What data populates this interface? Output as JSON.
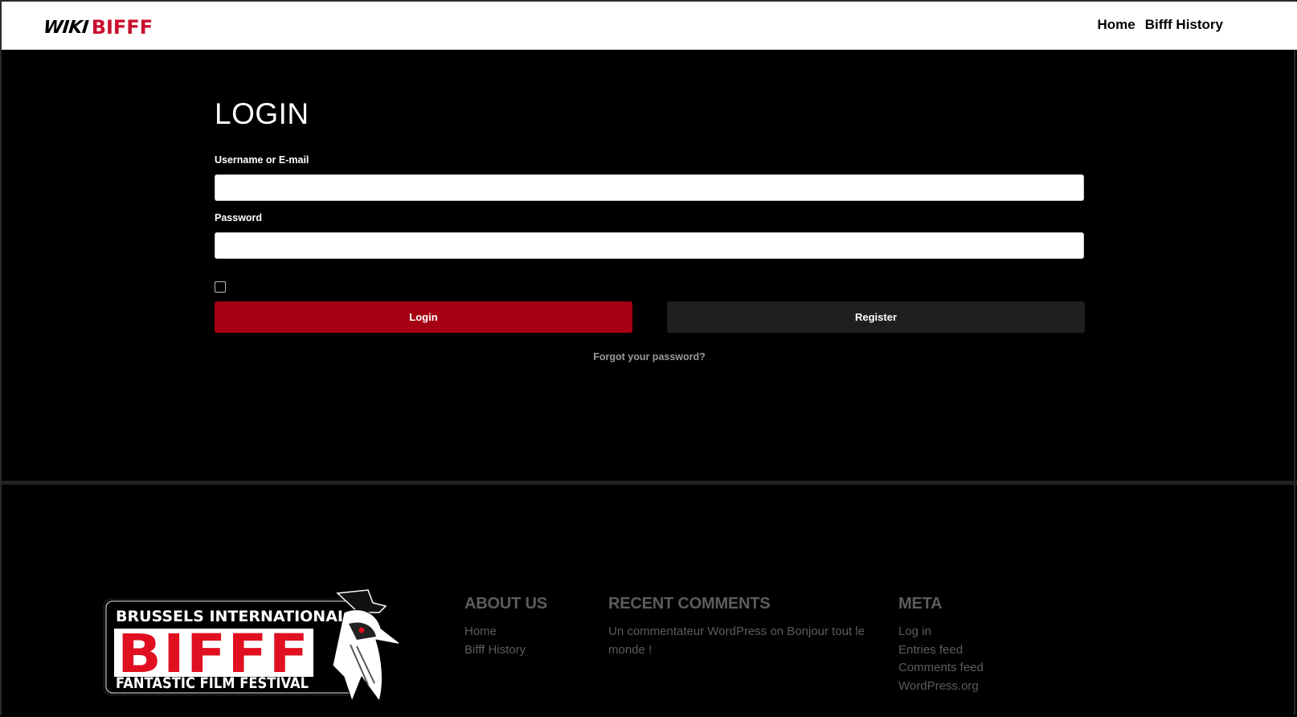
{
  "header": {
    "logo": {
      "wiki": "WIKI",
      "brand": "BIFFF"
    },
    "nav": [
      {
        "label": "Home"
      },
      {
        "label": "Bifff History"
      }
    ]
  },
  "login": {
    "title": "LOGIN",
    "username_label": "Username or E-mail",
    "username_value": "",
    "password_label": "Password",
    "password_value": "",
    "remember_checked": false,
    "login_button": "Login",
    "register_button": "Register",
    "forgot_link": "Forgot your password?"
  },
  "footer": {
    "logo": {
      "top_text": "BRUSSELS INTERNATIONAL",
      "brand": "BIFFF",
      "bottom_text": "FANTASTIC FILM FESTIVAL"
    },
    "about": {
      "title": "ABOUT US",
      "links": [
        {
          "label": "Home"
        },
        {
          "label": "Bifff History"
        }
      ]
    },
    "recent_comments": {
      "title": "RECENT COMMENTS",
      "comment": "Un commentateur WordPress on Bonjour tout le monde !"
    },
    "meta": {
      "title": "META",
      "links": [
        {
          "label": "Log in"
        },
        {
          "label": "Entries feed"
        },
        {
          "label": "Comments feed"
        },
        {
          "label": "WordPress.org"
        }
      ]
    }
  },
  "colors": {
    "brand_red": "#c8102e",
    "login_button": "#a70014",
    "register_button": "#1f1f1f",
    "background": "#000000",
    "footer_text": "#5c5c5c"
  }
}
